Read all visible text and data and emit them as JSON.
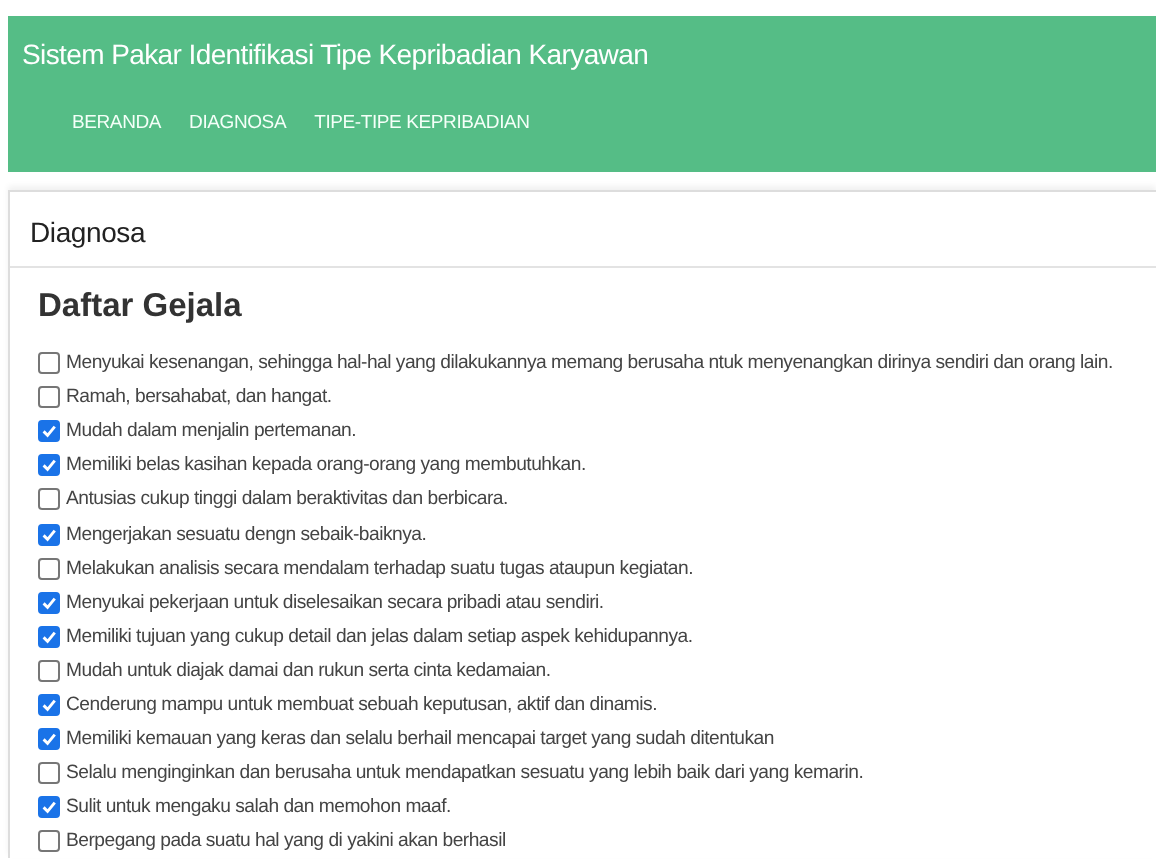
{
  "header": {
    "title": "Sistem Pakar Identifikasi Tipe Kepribadian Karyawan",
    "nav": [
      "BERANDA",
      "DIAGNOSA",
      "TIPE-TIPE KEPRIBADIAN"
    ]
  },
  "card": {
    "title": "Diagnosa",
    "heading": "Daftar Gejala",
    "symptoms": [
      {
        "label": "Menyukai kesenangan, sehingga hal-hal yang dilakukannya memang berusaha ntuk menyenangkan dirinya sendiri dan orang lain.",
        "checked": false
      },
      {
        "label": "Ramah, bersahabat, dan hangat.",
        "checked": false
      },
      {
        "label": "Mudah dalam menjalin pertemanan.",
        "checked": true
      },
      {
        "label": "Memiliki belas kasihan kepada orang-orang yang membutuhkan.",
        "checked": true
      },
      {
        "label": "Antusias cukup tinggi dalam beraktivitas dan berbicara.",
        "checked": false
      },
      {
        "label": "Mengerjakan sesuatu dengn sebaik-baiknya.",
        "checked": true
      },
      {
        "label": "Melakukan analisis secara mendalam terhadap suatu tugas ataupun kegiatan.",
        "checked": false
      },
      {
        "label": "Menyukai pekerjaan untuk diselesaikan secara pribadi atau sendiri.",
        "checked": true
      },
      {
        "label": "Memiliki tujuan yang cukup detail dan jelas dalam setiap aspek kehidupannya.",
        "checked": true
      },
      {
        "label": "Mudah untuk diajak damai dan rukun serta cinta kedamaian.",
        "checked": false
      },
      {
        "label": "Cenderung mampu untuk membuat sebuah keputusan, aktif dan dinamis.",
        "checked": true
      },
      {
        "label": "Memiliki kemauan yang keras dan selalu berhail mencapai target yang sudah ditentukan",
        "checked": true
      },
      {
        "label": "Selalu menginginkan dan berusaha untuk mendapatkan sesuatu yang lebih baik dari yang kemarin.",
        "checked": false
      },
      {
        "label": "Sulit untuk mengaku salah dan memohon maaf.",
        "checked": true
      },
      {
        "label": "Berpegang pada suatu hal yang di yakini akan berhasil",
        "checked": false
      }
    ]
  }
}
